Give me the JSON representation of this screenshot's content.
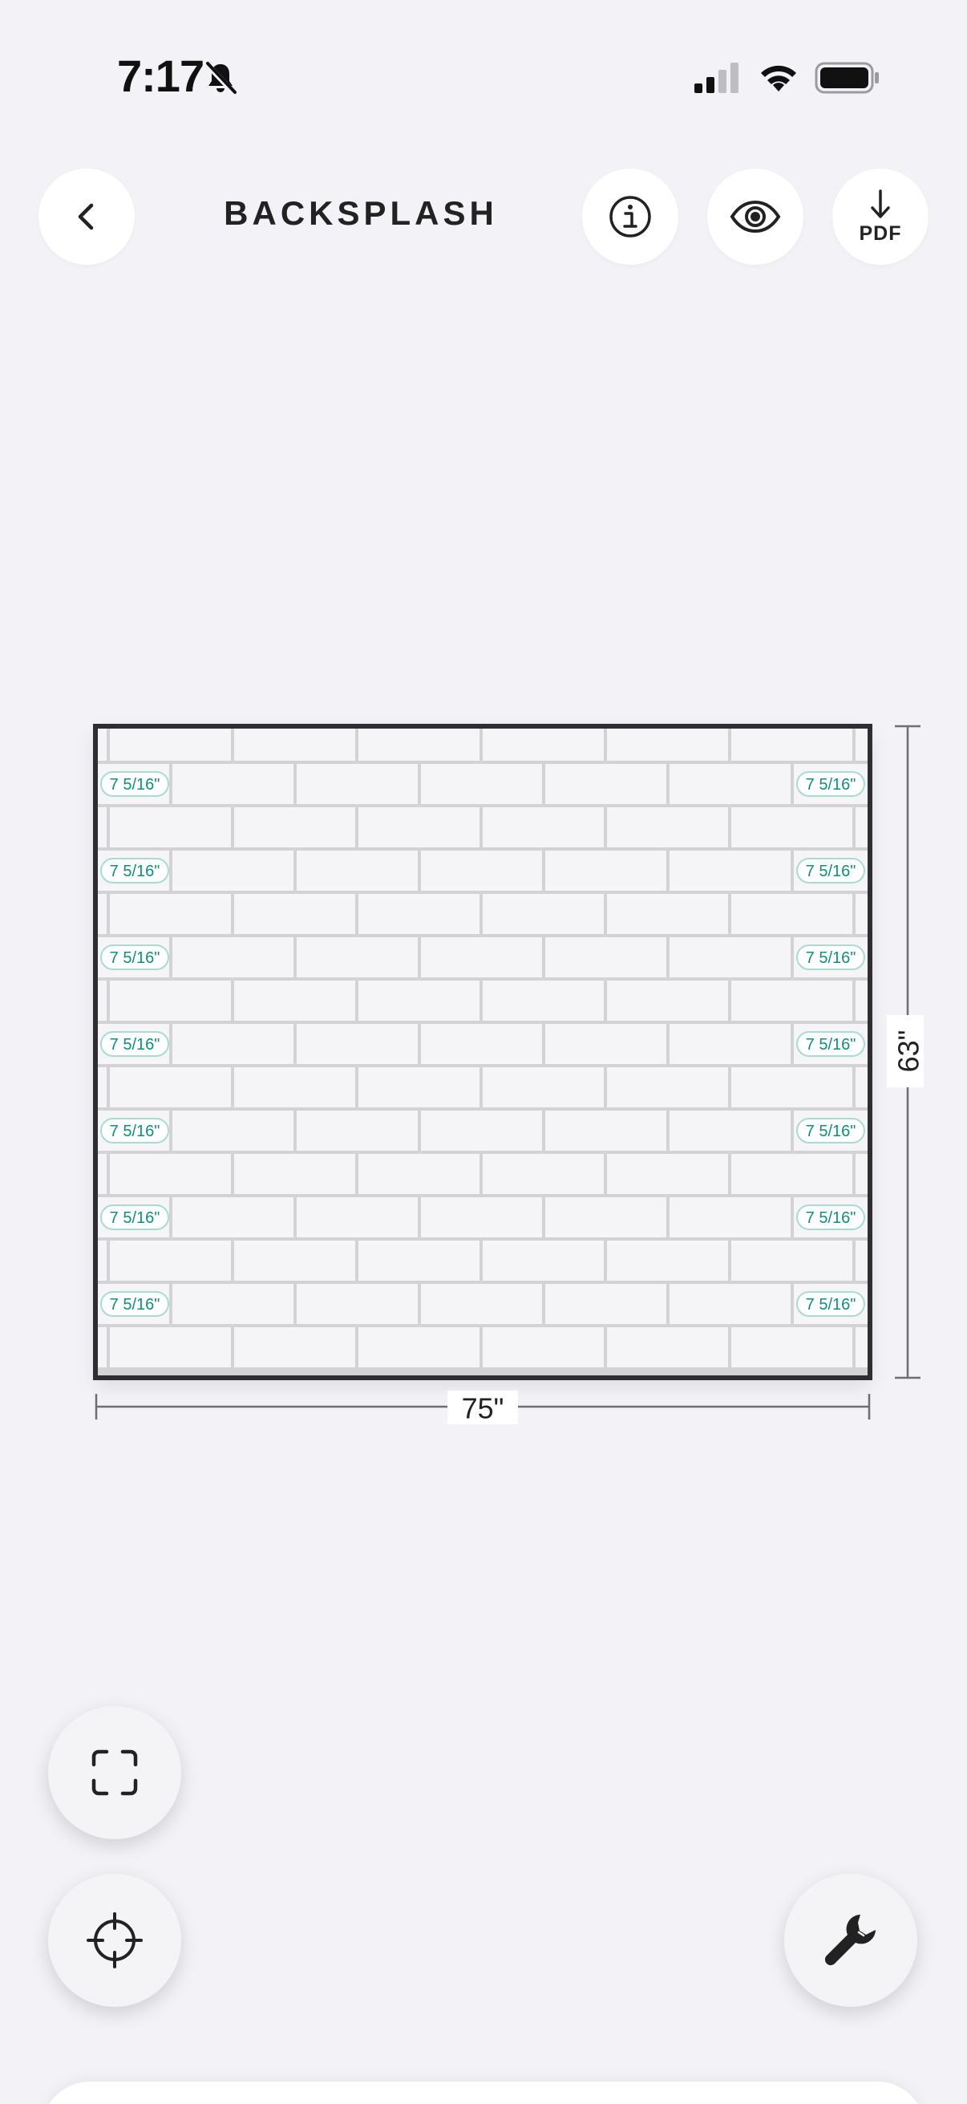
{
  "status_bar": {
    "time": "7:17",
    "mute_icon": "bell-slash-icon",
    "signal_icon": "cellular-signal-icon",
    "wifi_icon": "wifi-icon",
    "battery_icon": "battery-full-icon"
  },
  "header": {
    "title": "BACKSPLASH",
    "back_icon": "chevron-left-icon",
    "info_icon": "info-circle-icon",
    "preview_icon": "eye-icon",
    "pdf_label": "PDF",
    "pdf_icon": "arrow-down-icon"
  },
  "layout": {
    "width_label": "75\"",
    "height_label": "63\"",
    "cut_label": "7 5/16\"",
    "tile_rows": 15,
    "label_rows": 7,
    "colors": {
      "tile": "#f5f5f7",
      "grout": "#d3d3d3",
      "frame": "#2e2e32",
      "cut_label_text": "#0f8f7c",
      "cut_label_border": "#a8dcd2"
    }
  },
  "controls": {
    "fit_icon": "fit-screen-icon",
    "locate_icon": "crosshair-icon",
    "tools_icon": "wrench-icon"
  }
}
